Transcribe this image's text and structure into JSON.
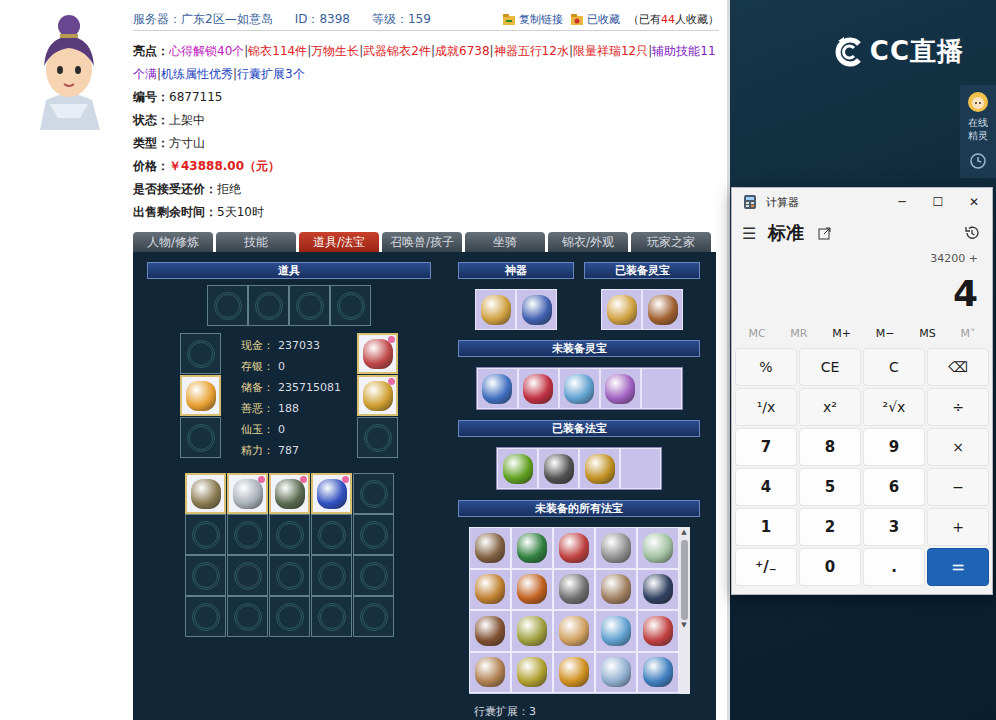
{
  "page": {
    "header": {
      "server_label": "服务器：",
      "server": "广东2区—如意岛",
      "id_label": "ID：",
      "id": "8398",
      "level_label": "等级：",
      "level": "159",
      "copy_link": "复制链接",
      "collected": "已收藏",
      "collect_prefix": "（已有",
      "collect_count": "44",
      "collect_suffix": "人收藏）"
    },
    "highlights_label": "亮点：",
    "separator": "|",
    "highlights": [
      {
        "text": "心得解锁40个",
        "color": "#c020c0"
      },
      {
        "text": "锦衣114件",
        "color": "#e02020"
      },
      {
        "text": "万物生长",
        "color": "#e02020"
      },
      {
        "text": "武器锦衣2件",
        "color": "#e02020"
      },
      {
        "text": "成就6738",
        "color": "#e02020"
      },
      {
        "text": "神器五行12水",
        "color": "#e02020"
      },
      {
        "text": "限量祥瑞12只",
        "color": "#e02020"
      },
      {
        "text": "辅助技能11个满",
        "color": "#8020c0"
      },
      {
        "text": "机练属性优秀",
        "color": "#2040c0"
      },
      {
        "text": "行囊扩展3个",
        "color": "#2040c0"
      }
    ],
    "fields": [
      {
        "label": "编号：",
        "value": "6877115",
        "kind": "plain"
      },
      {
        "label": "状态：",
        "value": "上架中",
        "kind": "plain"
      },
      {
        "label": "类型：",
        "value": "方寸山",
        "kind": "plain"
      },
      {
        "label": "价格：",
        "value": "￥43888.00（元）",
        "kind": "price"
      },
      {
        "label": "是否接受还价：",
        "value": "拒绝",
        "kind": "plain"
      },
      {
        "label": "出售剩余时间：",
        "value": "5天10时",
        "kind": "plain"
      }
    ]
  },
  "tabs": [
    {
      "label": "人物/修炼",
      "selected": false
    },
    {
      "label": "技能",
      "selected": false
    },
    {
      "label": "道具/法宝",
      "selected": true
    },
    {
      "label": "召唤兽/孩子",
      "selected": false
    },
    {
      "label": "坐骑",
      "selected": false
    },
    {
      "label": "锦衣/外观",
      "selected": false
    },
    {
      "label": "玩家之家",
      "selected": false
    }
  ],
  "panel": {
    "items_title": "道具",
    "top_slots": [
      {
        "filled": false,
        "badge": false
      },
      {
        "filled": false,
        "badge": false
      },
      {
        "filled": false,
        "badge": false
      },
      {
        "filled": false,
        "badge": false
      }
    ],
    "left_slots": [
      {
        "filled": false,
        "badge": false
      },
      {
        "filled": true,
        "badge": false,
        "color": "#e8a030"
      },
      {
        "filled": false,
        "badge": false
      }
    ],
    "right_slots": [
      {
        "filled": true,
        "badge": true,
        "color": "#c04848"
      },
      {
        "filled": true,
        "badge": true,
        "color": "#d0a030"
      },
      {
        "filled": false,
        "badge": false
      }
    ],
    "stats": [
      {
        "label": "现金：",
        "value": "237033"
      },
      {
        "label": "存银：",
        "value": "0"
      },
      {
        "label": "储备：",
        "value": "235715081"
      },
      {
        "label": "善恶：",
        "value": "188"
      },
      {
        "label": "仙玉：",
        "value": "0"
      },
      {
        "label": "精力：",
        "value": "787"
      }
    ],
    "bag": [
      {
        "filled": true,
        "badge": false,
        "color": "#8a7a50"
      },
      {
        "filled": true,
        "badge": true,
        "color": "#a8b0b8"
      },
      {
        "filled": true,
        "badge": true,
        "color": "#5a6a50"
      },
      {
        "filled": true,
        "badge": true,
        "color": "#3050c0"
      },
      {
        "filled": false,
        "badge": false
      },
      {
        "filled": false,
        "badge": false
      },
      {
        "filled": false,
        "badge": false
      },
      {
        "filled": false,
        "badge": false
      },
      {
        "filled": false,
        "badge": false
      },
      {
        "filled": false,
        "badge": false
      },
      {
        "filled": false,
        "badge": false
      },
      {
        "filled": false,
        "badge": false
      },
      {
        "filled": false,
        "badge": false
      },
      {
        "filled": false,
        "badge": false
      },
      {
        "filled": false,
        "badge": false
      },
      {
        "filled": false,
        "badge": false
      },
      {
        "filled": false,
        "badge": false
      },
      {
        "filled": false,
        "badge": false
      },
      {
        "filled": false,
        "badge": false
      },
      {
        "filled": false,
        "badge": false
      }
    ],
    "artifact_title": "神器",
    "artifacts": [
      {
        "filled": true,
        "badge": false,
        "color": "#d0a040"
      },
      {
        "filled": true,
        "badge": false,
        "color": "#4060b0"
      }
    ],
    "equipped_lingbao_title": "已装备灵宝",
    "equipped_lingbao": [
      {
        "filled": true,
        "badge": false,
        "color": "#d0a040"
      },
      {
        "filled": true,
        "badge": false,
        "color": "#a06030"
      }
    ],
    "lingbao_title": "未装备灵宝",
    "lingbao": [
      {
        "filled": true,
        "badge": false,
        "color": "#4070c0"
      },
      {
        "filled": true,
        "badge": false,
        "color": "#c03040"
      },
      {
        "filled": true,
        "badge": false,
        "color": "#60a0d0"
      },
      {
        "filled": true,
        "badge": false,
        "color": "#a060c0"
      },
      {
        "filled": false,
        "badge": false
      }
    ],
    "equipped_fabao_title": "已装备法宝",
    "equipped_fabao": [
      {
        "filled": true,
        "badge": false,
        "color": "#60a020"
      },
      {
        "filled": true,
        "badge": false,
        "color": "#505050"
      },
      {
        "filled": true,
        "badge": false,
        "color": "#c09020"
      },
      {
        "filled": false,
        "badge": false
      }
    ],
    "fabao_title": "未装备的所有法宝",
    "fabao": [
      {
        "filled": true,
        "badge": false,
        "color": "#806040"
      },
      {
        "filled": true,
        "badge": false,
        "color": "#308040"
      },
      {
        "filled": true,
        "badge": false,
        "color": "#c04040"
      },
      {
        "filled": true,
        "badge": false,
        "color": "#909090"
      },
      {
        "filled": true,
        "badge": false,
        "color": "#a0c0a0"
      },
      {
        "filled": true,
        "badge": false,
        "color": "#c08030"
      },
      {
        "filled": true,
        "badge": false,
        "color": "#c06020"
      },
      {
        "filled": true,
        "badge": false,
        "color": "#707070"
      },
      {
        "filled": true,
        "badge": false,
        "color": "#a08060"
      },
      {
        "filled": true,
        "badge": false,
        "color": "#304060"
      },
      {
        "filled": true,
        "badge": false,
        "color": "#805030"
      },
      {
        "filled": true,
        "badge": false,
        "color": "#a0a040"
      },
      {
        "filled": true,
        "badge": false,
        "color": "#d0a060"
      },
      {
        "filled": true,
        "badge": false,
        "color": "#60a0d0"
      },
      {
        "filled": true,
        "badge": false,
        "color": "#c04040"
      },
      {
        "filled": true,
        "badge": false,
        "color": "#b08050"
      },
      {
        "filled": true,
        "badge": false,
        "color": "#b0a030"
      },
      {
        "filled": true,
        "badge": false,
        "color": "#d09020"
      },
      {
        "filled": true,
        "badge": false,
        "color": "#90b0d0"
      },
      {
        "filled": true,
        "badge": false,
        "color": "#4080c0"
      }
    ],
    "bag_expand_label": "行囊扩展：",
    "bag_expand": "3"
  },
  "brand": {
    "name": "CC直播"
  },
  "side_widget": {
    "label": "在线精灵"
  },
  "calculator": {
    "title": "计算器",
    "minimize": "─",
    "maximize": "☐",
    "close": "✕",
    "menu": "☰",
    "mode": "标准",
    "expression": "34200 +",
    "display": "4",
    "memory": [
      {
        "label": "MC",
        "disabled": true
      },
      {
        "label": "MR",
        "disabled": true
      },
      {
        "label": "M+",
        "disabled": false
      },
      {
        "label": "M−",
        "disabled": false
      },
      {
        "label": "MS",
        "disabled": false
      },
      {
        "label": "M˅",
        "disabled": true
      }
    ],
    "keys": [
      {
        "label": "%",
        "kind": "op"
      },
      {
        "label": "CE",
        "kind": "op"
      },
      {
        "label": "C",
        "kind": "op"
      },
      {
        "label": "⌫",
        "kind": "op"
      },
      {
        "label": "¹/x",
        "kind": "op"
      },
      {
        "label": "x²",
        "kind": "op"
      },
      {
        "label": "²√x",
        "kind": "op"
      },
      {
        "label": "÷",
        "kind": "op"
      },
      {
        "label": "7",
        "kind": "digit"
      },
      {
        "label": "8",
        "kind": "digit"
      },
      {
        "label": "9",
        "kind": "digit"
      },
      {
        "label": "×",
        "kind": "op"
      },
      {
        "label": "4",
        "kind": "digit"
      },
      {
        "label": "5",
        "kind": "digit"
      },
      {
        "label": "6",
        "kind": "digit"
      },
      {
        "label": "−",
        "kind": "op"
      },
      {
        "label": "1",
        "kind": "digit"
      },
      {
        "label": "2",
        "kind": "digit"
      },
      {
        "label": "3",
        "kind": "digit"
      },
      {
        "label": "+",
        "kind": "op"
      },
      {
        "label": "⁺/₋",
        "kind": "digit"
      },
      {
        "label": "0",
        "kind": "digit"
      },
      {
        "label": ".",
        "kind": "digit"
      },
      {
        "label": "=",
        "kind": "equals"
      }
    ]
  }
}
